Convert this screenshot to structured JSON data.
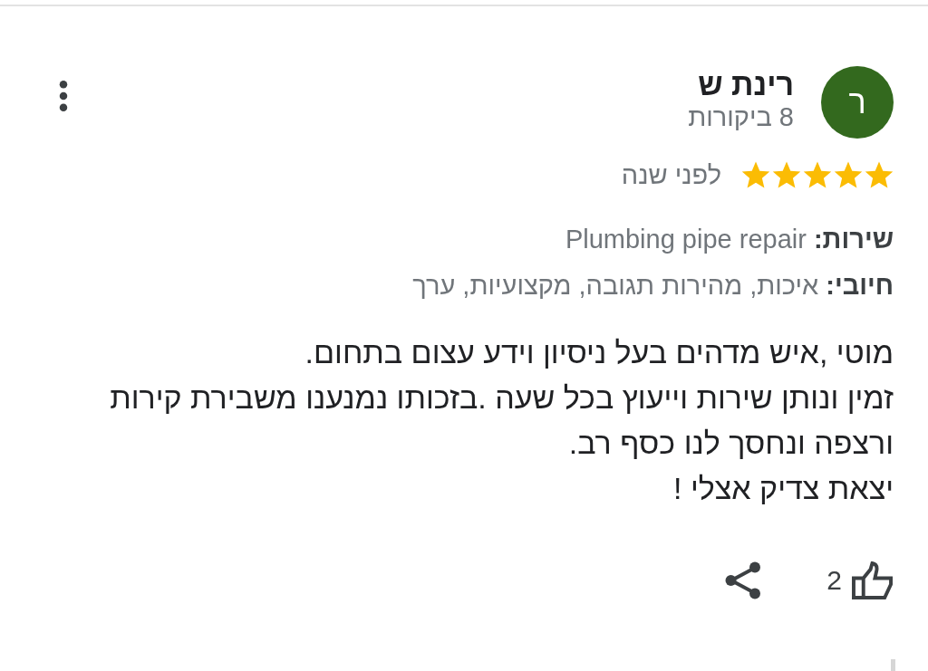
{
  "review": {
    "author_initial": "ר",
    "author_name": "רינת ש",
    "author_reviews": "8 ביקורות",
    "stars": 5,
    "time": "לפני שנה",
    "details": [
      "**שירות:** Plumbing pipe repair",
      "**חיובי:** איכות, מהירות תגובה, מקצועיות, ערך"
    ],
    "text": "מוטי ,איש מדהים בעל ניסיון וידע עצום בתחום.\nזמין ונותן שירות וייעוץ בכל שעה .בזכותו נמנענו משבירת קירות\nורצפה ונחסך לנו כסף רב.\nיצאת צדיק אצלי !",
    "likes": "2"
  }
}
